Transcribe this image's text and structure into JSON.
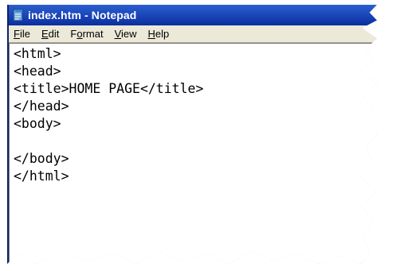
{
  "window": {
    "title": "index.htm - Notepad",
    "icon": "notepad-icon"
  },
  "menu": {
    "file": {
      "accel": "F",
      "rest": "ile"
    },
    "edit": {
      "accel": "E",
      "rest": "dit"
    },
    "format": {
      "pre": "F",
      "accel": "o",
      "rest": "rmat"
    },
    "view": {
      "accel": "V",
      "rest": "iew"
    },
    "help": {
      "accel": "H",
      "rest": "elp"
    }
  },
  "editor": {
    "lines": [
      "<html>",
      "<head>",
      "<title>HOME PAGE</title>",
      "</head>",
      "<body>",
      "",
      "</body>",
      "</html>"
    ]
  },
  "colors": {
    "titlebar": "#1b46b8",
    "menubar": "#ece9d8",
    "editor_bg": "#ffffff"
  }
}
